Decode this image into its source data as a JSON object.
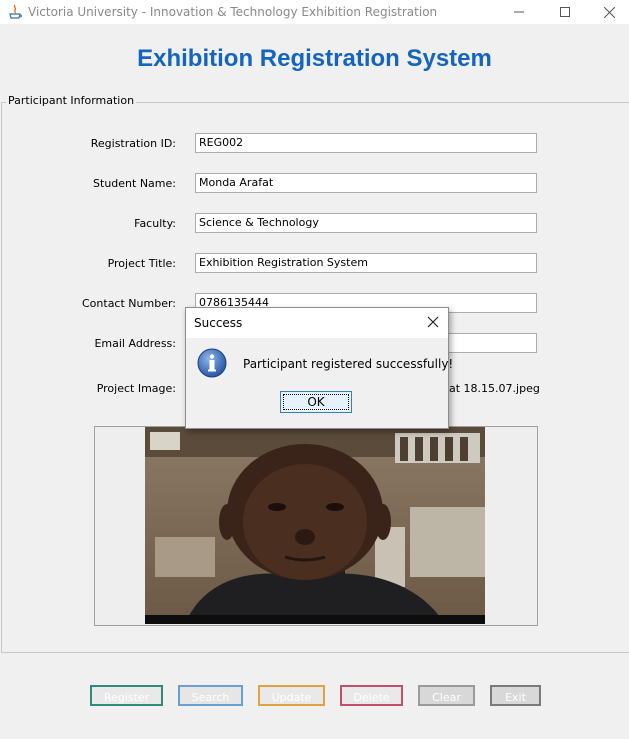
{
  "window": {
    "title": "Victoria University - Innovation & Technology Exhibition Registration",
    "minimize_icon": "minimize-icon",
    "maximize_icon": "maximize-icon",
    "close_icon": "close-icon"
  },
  "header": {
    "title": "Exhibition Registration System",
    "color": "#1565c0"
  },
  "form": {
    "group_title": "Participant Information",
    "registration_id": {
      "label": "Registration ID:",
      "value": "REG002"
    },
    "student_name": {
      "label": "Student Name:",
      "value": "Monda Arafat"
    },
    "faculty": {
      "label": "Faculty:",
      "value": "Science & Technology"
    },
    "project_title": {
      "label": "Project Title:",
      "value": "Exhibition Registration System"
    },
    "contact_number": {
      "label": "Contact Number:",
      "value": "0786135444"
    },
    "email_address": {
      "label": "Email Address:",
      "value": ""
    },
    "project_image": {
      "label": "Project Image:",
      "path_visible": "at 18.15.07.jpeg"
    }
  },
  "buttons": {
    "register": {
      "label": "Register",
      "border": "#2e8b7a"
    },
    "search": {
      "label": "Search",
      "border": "#6a9fd4"
    },
    "update": {
      "label": "Update",
      "border": "#e0a341"
    },
    "delete": {
      "label": "Delete",
      "border": "#c0506a"
    },
    "clear": {
      "label": "Clear",
      "border": "#9a9a9a"
    },
    "exit": {
      "label": "Exit",
      "border": "#7a7a7a"
    }
  },
  "dialog": {
    "title": "Success",
    "message": "Participant registered successfully!",
    "ok_label": "OK",
    "icon": "info-icon"
  }
}
